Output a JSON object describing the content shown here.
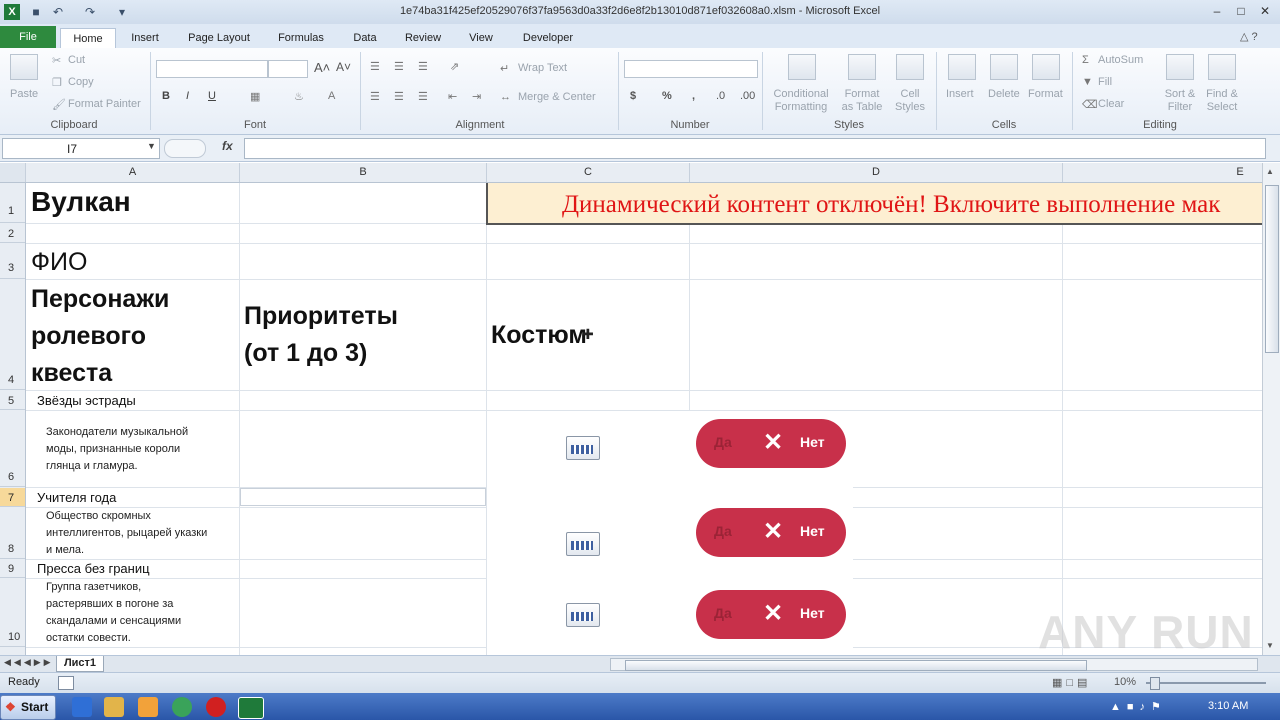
{
  "window": {
    "title": "1e74ba31f425ef20529076f37fa9563d0a33f2d6e8f2b13010d871ef032608a0.xlsm - Microsoft Excel",
    "minimize": "–",
    "maximize": "□",
    "close": "✕"
  },
  "ribbon_tabs": [
    "File",
    "Home",
    "Insert",
    "Page Layout",
    "Formulas",
    "Data",
    "Review",
    "View",
    "Developer"
  ],
  "clipboard": {
    "paste": "Paste",
    "cut": "Cut",
    "copy": "Copy",
    "format_painter": "Format Painter",
    "label": "Clipboard"
  },
  "font": {
    "bold": "B",
    "italic": "I",
    "underline": "U",
    "grow": "A˄",
    "shrink": "A˅",
    "label": "Font"
  },
  "alignment": {
    "wrap": "Wrap Text",
    "merge": "Merge & Center",
    "label": "Alignment"
  },
  "number": {
    "currency": "$",
    "percent": "%",
    "comma": ",",
    "label": "Number"
  },
  "styles": {
    "conditional": "Conditional Formatting",
    "format_table": "Format as Table",
    "cell_styles": "Cell Styles",
    "label": "Styles"
  },
  "cells": {
    "insert": "Insert",
    "delete": "Delete",
    "format": "Format",
    "label": "Cells"
  },
  "editing": {
    "autosum": "AutoSum",
    "fill": "Fill",
    "clear": "Clear",
    "sort": "Sort & Filter",
    "find": "Find & Select",
    "label": "Editing"
  },
  "formula_bar": {
    "name_box": "I7",
    "fx": "fx",
    "value": ""
  },
  "columns": [
    "A",
    "B",
    "C",
    "D",
    "E"
  ],
  "rows": [
    "1",
    "2",
    "3",
    "4",
    "5",
    "6",
    "7",
    "8",
    "9",
    "10"
  ],
  "selected_row": "7",
  "sheet": {
    "title": "Вулкан",
    "banner": "Динамический контент отключён! Включите выполнение мак",
    "fio": "ФИО",
    "header_a": [
      "Персонажи",
      "ролевого",
      "квеста"
    ],
    "header_b": [
      "Приоритеты",
      "(от 1 до 3)"
    ],
    "header_c": "Костюм",
    "groups": [
      {
        "name": "Звёзды эстрады",
        "desc": [
          "Законодатели музыкальной",
          "моды, признанные короли",
          "глянца и гламура."
        ]
      },
      {
        "name": "Учителя года",
        "desc": [
          "Общество скромных",
          "интеллигентов, рыцарей указки",
          "и мела."
        ]
      },
      {
        "name": "Пресса без границ",
        "desc": [
          "Группа газетчиков,",
          "растерявших в погоне за",
          "скандалами и сенсациями",
          "остатки совести."
        ]
      }
    ],
    "toggle": {
      "yes": "Да",
      "x": "✕",
      "no": "Нет"
    }
  },
  "sheet_tabs": [
    "Лист1"
  ],
  "status": {
    "ready": "Ready",
    "zoom": "10%"
  },
  "taskbar": {
    "start": "Start",
    "clock": "3:10 AM"
  },
  "watermark": "ANY RUN"
}
